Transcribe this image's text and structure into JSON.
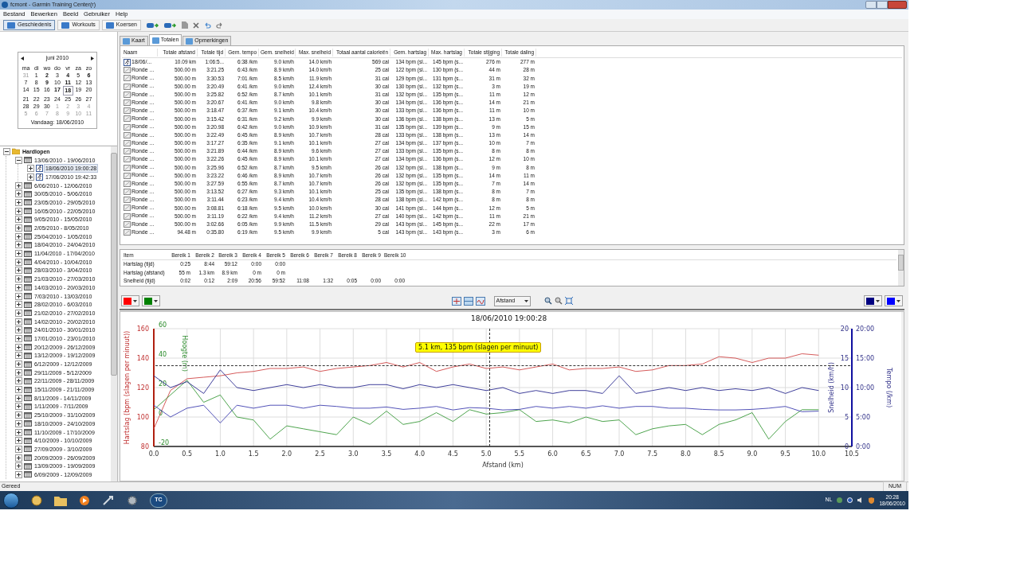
{
  "window": {
    "title": "fcmont - Garmin Training Center(r)"
  },
  "menu": [
    "Bestand",
    "Bewerken",
    "Beeld",
    "Gebruiker",
    "Help"
  ],
  "toolbar": {
    "views": [
      {
        "label": "Geschiedenis",
        "selected": true
      },
      {
        "label": "Workouts",
        "selected": false
      },
      {
        "label": "Koersen",
        "selected": false
      }
    ]
  },
  "calendar": {
    "month": "juni 2010",
    "weekdays": [
      "ma",
      "di",
      "wo",
      "do",
      "vr",
      "za",
      "zo"
    ],
    "weeks": [
      [
        {
          "d": "31",
          "kind": "other"
        },
        {
          "d": "1",
          "kind": "plain"
        },
        {
          "d": "2",
          "kind": "active"
        },
        {
          "d": "3",
          "kind": "plain"
        },
        {
          "d": "4",
          "kind": "active"
        },
        {
          "d": "5",
          "kind": "plain"
        },
        {
          "d": "6",
          "kind": "active"
        }
      ],
      [
        {
          "d": "7",
          "kind": "plain"
        },
        {
          "d": "8",
          "kind": "plain"
        },
        {
          "d": "9",
          "kind": "active"
        },
        {
          "d": "10",
          "kind": "plain"
        },
        {
          "d": "11",
          "kind": "active"
        },
        {
          "d": "12",
          "kind": "plain"
        },
        {
          "d": "13",
          "kind": "plain"
        }
      ],
      [
        {
          "d": "14",
          "kind": "plain"
        },
        {
          "d": "15",
          "kind": "plain"
        },
        {
          "d": "16",
          "kind": "plain"
        },
        {
          "d": "17",
          "kind": "active"
        },
        {
          "d": "18",
          "kind": "today"
        },
        {
          "d": "19",
          "kind": "plain"
        },
        {
          "d": "20",
          "kind": "plain"
        }
      ],
      [
        {
          "d": "21",
          "kind": "plain"
        },
        {
          "d": "22",
          "kind": "plain"
        },
        {
          "d": "23",
          "kind": "plain"
        },
        {
          "d": "24",
          "kind": "plain"
        },
        {
          "d": "25",
          "kind": "plain"
        },
        {
          "d": "26",
          "kind": "plain"
        },
        {
          "d": "27",
          "kind": "plain"
        }
      ],
      [
        {
          "d": "28",
          "kind": "plain"
        },
        {
          "d": "29",
          "kind": "plain"
        },
        {
          "d": "30",
          "kind": "plain"
        },
        {
          "d": "1",
          "kind": "other"
        },
        {
          "d": "2",
          "kind": "other"
        },
        {
          "d": "3",
          "kind": "other"
        },
        {
          "d": "4",
          "kind": "other"
        }
      ],
      [
        {
          "d": "5",
          "kind": "other"
        },
        {
          "d": "6",
          "kind": "other"
        },
        {
          "d": "7",
          "kind": "other"
        },
        {
          "d": "8",
          "kind": "other"
        },
        {
          "d": "9",
          "kind": "other"
        },
        {
          "d": "10",
          "kind": "other"
        },
        {
          "d": "11",
          "kind": "other"
        }
      ]
    ],
    "today": "Vandaag: 18/06/2010"
  },
  "tree": {
    "label": "Hardlopen",
    "kind": "folder",
    "expanded": true,
    "selected": false,
    "children": [
      {
        "label": "13/06/2010 - 19/06/2010",
        "kind": "week",
        "expanded": true,
        "selected": false,
        "children": [
          {
            "label": "18/06/2010 19:00:28",
            "kind": "activity",
            "expanded": false,
            "selected": true
          },
          {
            "label": "17/06/2010 19:42:33",
            "kind": "activity",
            "expanded": false,
            "selected": false
          }
        ]
      },
      {
        "label": "6/06/2010 - 12/06/2010",
        "kind": "week",
        "expanded": false,
        "selected": false
      },
      {
        "label": "30/05/2010 - 5/06/2010",
        "kind": "week",
        "expanded": false,
        "selected": false
      },
      {
        "label": "23/05/2010 - 29/05/2010",
        "kind": "week",
        "expanded": false,
        "selected": false
      },
      {
        "label": "16/05/2010 - 22/05/2010",
        "kind": "week",
        "expanded": false,
        "selected": false
      },
      {
        "label": "9/05/2010 - 15/05/2010",
        "kind": "week",
        "expanded": false,
        "selected": false
      },
      {
        "label": "2/05/2010 - 8/05/2010",
        "kind": "week",
        "expanded": false,
        "selected": false
      },
      {
        "label": "25/04/2010 - 1/05/2010",
        "kind": "week",
        "expanded": false,
        "selected": false
      },
      {
        "label": "18/04/2010 - 24/04/2010",
        "kind": "week",
        "expanded": false,
        "selected": false
      },
      {
        "label": "11/04/2010 - 17/04/2010",
        "kind": "week",
        "expanded": false,
        "selected": false
      },
      {
        "label": "4/04/2010 - 10/04/2010",
        "kind": "week",
        "expanded": false,
        "selected": false
      },
      {
        "label": "28/03/2010 - 3/04/2010",
        "kind": "week",
        "expanded": false,
        "selected": false
      },
      {
        "label": "21/03/2010 - 27/03/2010",
        "kind": "week",
        "expanded": false,
        "selected": false
      },
      {
        "label": "14/03/2010 - 20/03/2010",
        "kind": "week",
        "expanded": false,
        "selected": false
      },
      {
        "label": "7/03/2010 - 13/03/2010",
        "kind": "week",
        "expanded": false,
        "selected": false
      },
      {
        "label": "28/02/2010 - 6/03/2010",
        "kind": "week",
        "expanded": false,
        "selected": false
      },
      {
        "label": "21/02/2010 - 27/02/2010",
        "kind": "week",
        "expanded": false,
        "selected": false
      },
      {
        "label": "14/02/2010 - 20/02/2010",
        "kind": "week",
        "expanded": false,
        "selected": false
      },
      {
        "label": "24/01/2010 - 30/01/2010",
        "kind": "week",
        "expanded": false,
        "selected": false
      },
      {
        "label": "17/01/2010 - 23/01/2010",
        "kind": "week",
        "expanded": false,
        "selected": false
      },
      {
        "label": "20/12/2009 - 26/12/2009",
        "kind": "week",
        "expanded": false,
        "selected": false
      },
      {
        "label": "13/12/2009 - 19/12/2009",
        "kind": "week",
        "expanded": false,
        "selected": false
      },
      {
        "label": "6/12/2009 - 12/12/2009",
        "kind": "week",
        "expanded": false,
        "selected": false
      },
      {
        "label": "29/11/2009 - 5/12/2009",
        "kind": "week",
        "expanded": false,
        "selected": false
      },
      {
        "label": "22/11/2009 - 28/11/2009",
        "kind": "week",
        "expanded": false,
        "selected": false
      },
      {
        "label": "15/11/2009 - 21/11/2009",
        "kind": "week",
        "expanded": false,
        "selected": false
      },
      {
        "label": "8/11/2009 - 14/11/2009",
        "kind": "week",
        "expanded": false,
        "selected": false
      },
      {
        "label": "1/11/2009 - 7/11/2009",
        "kind": "week",
        "expanded": false,
        "selected": false
      },
      {
        "label": "25/10/2009 - 31/10/2009",
        "kind": "week",
        "expanded": false,
        "selected": false
      },
      {
        "label": "18/10/2009 - 24/10/2009",
        "kind": "week",
        "expanded": false,
        "selected": false
      },
      {
        "label": "11/10/2009 - 17/10/2009",
        "kind": "week",
        "expanded": false,
        "selected": false
      },
      {
        "label": "4/10/2009 - 10/10/2009",
        "kind": "week",
        "expanded": false,
        "selected": false
      },
      {
        "label": "27/09/2009 - 3/10/2009",
        "kind": "week",
        "expanded": false,
        "selected": false
      },
      {
        "label": "20/09/2009 - 26/09/2009",
        "kind": "week",
        "expanded": false,
        "selected": false
      },
      {
        "label": "13/09/2009 - 19/09/2009",
        "kind": "week",
        "expanded": false,
        "selected": false
      },
      {
        "label": "6/09/2009 - 12/09/2009",
        "kind": "week",
        "expanded": false,
        "selected": false
      }
    ]
  },
  "tabs": [
    {
      "label": "Kaart",
      "selected": false
    },
    {
      "label": "Totalen",
      "selected": true
    },
    {
      "label": "Opmerkingen",
      "selected": false
    }
  ],
  "laps": {
    "columns": [
      "Naam",
      "Totale afstand",
      "Totale tijd",
      "Gem. tempo",
      "Gem. snelheid",
      "Max. snelheid",
      "Totaal aantal calorieën",
      "Gem. hartslag",
      "Max. hartslag",
      "Totale stijging",
      "Totale daling"
    ],
    "rows": [
      {
        "kind": "activity",
        "cells": [
          "18/06/...",
          "10.09 km",
          "1:06:5...",
          "6:38 /km",
          "9.0 km/h",
          "14.0 km/h",
          "569 cal",
          "134 bpm (sl...",
          "145 bpm (s...",
          "276 m",
          "277 m"
        ]
      },
      {
        "kind": "lap",
        "cells": [
          "Ronde ...",
          "500.00 m",
          "3:21.25",
          "6:43 /km",
          "8.9 km/h",
          "14.0 km/h",
          "25 cal",
          "122 bpm (sl...",
          "130 bpm (s...",
          "44 m",
          "28 m"
        ]
      },
      {
        "kind": "lap",
        "cells": [
          "Ronde ...",
          "500.00 m",
          "3:30.53",
          "7:01 /km",
          "8.5 km/h",
          "11.9 km/h",
          "31 cal",
          "129 bpm (sl...",
          "131 bpm (s...",
          "31 m",
          "32 m"
        ]
      },
      {
        "kind": "lap",
        "cells": [
          "Ronde ...",
          "500.00 m",
          "3:20.49",
          "6:41 /km",
          "9.0 km/h",
          "12.4 km/h",
          "30 cal",
          "130 bpm (sl...",
          "132 bpm (s...",
          "3 m",
          "19 m"
        ]
      },
      {
        "kind": "lap",
        "cells": [
          "Ronde ...",
          "500.00 m",
          "3:25.82",
          "6:52 /km",
          "8.7 km/h",
          "10.1 km/h",
          "31 cal",
          "132 bpm (sl...",
          "135 bpm (s...",
          "11 m",
          "12 m"
        ]
      },
      {
        "kind": "lap",
        "cells": [
          "Ronde ...",
          "500.00 m",
          "3:20.67",
          "6:41 /km",
          "9.0 km/h",
          "9.8 km/h",
          "30 cal",
          "134 bpm (sl...",
          "136 bpm (s...",
          "14 m",
          "21 m"
        ]
      },
      {
        "kind": "lap",
        "cells": [
          "Ronde ...",
          "500.00 m",
          "3:18.47",
          "6:37 /km",
          "9.1 km/h",
          "10.4 km/h",
          "30 cal",
          "133 bpm (sl...",
          "136 bpm (s...",
          "11 m",
          "10 m"
        ]
      },
      {
        "kind": "lap",
        "cells": [
          "Ronde ...",
          "500.00 m",
          "3:15.42",
          "6:31 /km",
          "9.2 km/h",
          "9.9 km/h",
          "30 cal",
          "136 bpm (sl...",
          "138 bpm (s...",
          "13 m",
          "5 m"
        ]
      },
      {
        "kind": "lap",
        "cells": [
          "Ronde ...",
          "500.00 m",
          "3:20.98",
          "6:42 /km",
          "9.0 km/h",
          "10.9 km/h",
          "31 cal",
          "135 bpm (sl...",
          "139 bpm (s...",
          "9 m",
          "15 m"
        ]
      },
      {
        "kind": "lap",
        "cells": [
          "Ronde ...",
          "500.00 m",
          "3:22.49",
          "6:45 /km",
          "8.9 km/h",
          "10.7 km/h",
          "28 cal",
          "133 bpm (sl...",
          "138 bpm (s...",
          "13 m",
          "14 m"
        ]
      },
      {
        "kind": "lap",
        "cells": [
          "Ronde ...",
          "500.00 m",
          "3:17.27",
          "6:35 /km",
          "9.1 km/h",
          "10.1 km/h",
          "27 cal",
          "134 bpm (sl...",
          "137 bpm (s...",
          "10 m",
          "7 m"
        ]
      },
      {
        "kind": "lap",
        "cells": [
          "Ronde ...",
          "500.00 m",
          "3:21.89",
          "6:44 /km",
          "8.9 km/h",
          "9.6 km/h",
          "27 cal",
          "133 bpm (sl...",
          "135 bpm (s...",
          "8 m",
          "8 m"
        ]
      },
      {
        "kind": "lap",
        "cells": [
          "Ronde ...",
          "500.00 m",
          "3:22.26",
          "6:45 /km",
          "8.9 km/h",
          "10.1 km/h",
          "27 cal",
          "134 bpm (sl...",
          "136 bpm (s...",
          "12 m",
          "10 m"
        ]
      },
      {
        "kind": "lap",
        "cells": [
          "Ronde ...",
          "500.00 m",
          "3:25.96",
          "6:52 /km",
          "8.7 km/h",
          "9.5 km/h",
          "26 cal",
          "132 bpm (sl...",
          "138 bpm (s...",
          "9 m",
          "8 m"
        ]
      },
      {
        "kind": "lap",
        "cells": [
          "Ronde ...",
          "500.00 m",
          "3:23.22",
          "6:46 /km",
          "8.9 km/h",
          "10.7 km/h",
          "26 cal",
          "132 bpm (sl...",
          "135 bpm (s...",
          "14 m",
          "11 m"
        ]
      },
      {
        "kind": "lap",
        "cells": [
          "Ronde ...",
          "500.00 m",
          "3:27.59",
          "6:55 /km",
          "8.7 km/h",
          "10.7 km/h",
          "26 cal",
          "132 bpm (sl...",
          "135 bpm (s...",
          "7 m",
          "14 m"
        ]
      },
      {
        "kind": "lap",
        "cells": [
          "Ronde ...",
          "500.00 m",
          "3:13.52",
          "6:27 /km",
          "9.3 km/h",
          "10.1 km/h",
          "25 cal",
          "135 bpm (sl...",
          "138 bpm (s...",
          "8 m",
          "7 m"
        ]
      },
      {
        "kind": "lap",
        "cells": [
          "Ronde ...",
          "500.00 m",
          "3:11.44",
          "6:23 /km",
          "9.4 km/h",
          "10.4 km/h",
          "28 cal",
          "138 bpm (sl...",
          "142 bpm (s...",
          "8 m",
          "8 m"
        ]
      },
      {
        "kind": "lap",
        "cells": [
          "Ronde ...",
          "500.00 m",
          "3:08.81",
          "6:18 /km",
          "9.5 km/h",
          "10.0 km/h",
          "30 cal",
          "141 bpm (sl...",
          "144 bpm (s...",
          "12 m",
          "5 m"
        ]
      },
      {
        "kind": "lap",
        "cells": [
          "Ronde ...",
          "500.00 m",
          "3:11.19",
          "6:22 /km",
          "9.4 km/h",
          "11.2 km/h",
          "27 cal",
          "140 bpm (sl...",
          "142 bpm (s...",
          "11 m",
          "21 m"
        ]
      },
      {
        "kind": "lap",
        "cells": [
          "Ronde ...",
          "500.00 m",
          "3:02.66",
          "6:05 /km",
          "9.9 km/h",
          "11.5 km/h",
          "29 cal",
          "143 bpm (sl...",
          "145 bpm (s...",
          "22 m",
          "17 m"
        ]
      },
      {
        "kind": "lap",
        "cells": [
          "Ronde ...",
          "94.48 m",
          "0:35.80",
          "6:19 /km",
          "9.5 km/h",
          "9.9 km/h",
          "5 cal",
          "143 bpm (sl...",
          "143 bpm (s...",
          "3 m",
          "6 m"
        ]
      }
    ]
  },
  "zones": {
    "columns": [
      "Item",
      "Bereik 1",
      "Bereik 2",
      "Bereik 3",
      "Bereik 4",
      "Bereik 5",
      "Bereik 6",
      "Bereik 7",
      "Bereik 8",
      "Bereik 9",
      "Bereik 10"
    ],
    "rows": [
      [
        "Hartslag (tijd)",
        "0:25",
        "8:44",
        "59:12",
        "0:00",
        "0:00"
      ],
      [
        "Hartslag (afstand)",
        "55 m",
        "1.3 km",
        "8.9 km",
        "0 m",
        "0 m"
      ],
      [
        "Snelheid (tijd)",
        "0:02",
        "0:12",
        "2:09",
        "20:56",
        "59:52",
        "11:08",
        "1:32",
        "0:05",
        "0:00",
        "0:00"
      ]
    ]
  },
  "chart_toolbar": {
    "left_colors": [
      {
        "color": "#ff0000"
      },
      {
        "color": "#008000"
      }
    ],
    "x_axis": "Afstand",
    "right_colors": [
      {
        "color": "#000080"
      },
      {
        "color": "#0000ff"
      }
    ]
  },
  "chart": {
    "title": "18/06/2010 19:00:28",
    "tooltip": "5.1 km, 135 bpm (slagen per minuut)",
    "plots": [
      {
        "kind": "heartrate",
        "chart_data": {
          "type": "line",
          "grid": true,
          "xlabel": "Afstand (km)",
          "ylabel": "Hartslag (bpm (slagen per minuut))",
          "xlim": [
            0,
            10.5
          ],
          "ylim": [
            80,
            160
          ],
          "x": [
            0,
            0.25,
            0.5,
            0.75,
            1,
            1.25,
            1.5,
            1.75,
            2,
            2.25,
            2.5,
            2.75,
            3,
            3.25,
            3.5,
            3.75,
            4,
            4.25,
            4.5,
            4.75,
            5,
            5.25,
            5.5,
            5.75,
            6,
            6.25,
            6.5,
            6.75,
            7,
            7.25,
            7.5,
            7.75,
            8,
            8.25,
            8.5,
            8.75,
            9,
            9.25,
            9.5,
            9.75,
            10
          ],
          "xticks": [
            {
              "value": 0,
              "label": "0.0"
            },
            {
              "value": 0.5,
              "label": "0.5"
            },
            {
              "value": 1,
              "label": "1.0"
            },
            {
              "value": 1.5,
              "label": "1.5"
            },
            {
              "value": 2,
              "label": "2.0"
            },
            {
              "value": 2.5,
              "label": "2.5"
            },
            {
              "value": 3,
              "label": "3.0"
            },
            {
              "value": 3.5,
              "label": "3.5"
            },
            {
              "value": 4,
              "label": "4.0"
            },
            {
              "value": 4.5,
              "label": "4.5"
            },
            {
              "value": 5,
              "label": "5.0"
            },
            {
              "value": 5.5,
              "label": "5.5"
            },
            {
              "value": 6,
              "label": "6.0"
            },
            {
              "value": 6.5,
              "label": "6.5"
            },
            {
              "value": 7,
              "label": "7.0"
            },
            {
              "value": 7.5,
              "label": "7.5"
            },
            {
              "value": 8,
              "label": "8.0"
            },
            {
              "value": 8.5,
              "label": "8.5"
            },
            {
              "value": 9,
              "label": "9.0"
            },
            {
              "value": 9.5,
              "label": "9.5"
            },
            {
              "value": 10,
              "label": "10.0"
            },
            {
              "value": 10.5,
              "label": "10.5"
            }
          ],
          "yticks": [
            80,
            100,
            120,
            140,
            160
          ],
          "series": [
            {
              "color": "#d04848",
              "values": [
                92,
                118,
                126,
                127,
                128,
                130,
                131,
                133,
                133,
                134,
                131,
                133,
                134,
                135,
                137,
                134,
                137,
                131,
                134,
                136,
                133,
                134,
                132,
                134,
                136,
                132,
                133,
                133,
                134,
                131,
                132,
                135,
                135,
                136,
                141,
                140,
                137,
                140,
                140,
                143,
                142
              ]
            }
          ]
        }
      },
      {
        "kind": "elevation",
        "chart_data": {
          "type": "line",
          "ylabel": "Hoogte (m)",
          "xlim": [
            0,
            10.5
          ],
          "ylim": [
            -20,
            60
          ],
          "x": [
            0,
            0.25,
            0.5,
            0.75,
            1,
            1.25,
            1.5,
            1.75,
            2,
            2.25,
            2.5,
            2.75,
            3,
            3.25,
            3.5,
            3.75,
            4,
            4.25,
            4.5,
            4.75,
            5,
            5.25,
            5.5,
            5.75,
            6,
            6.25,
            6.5,
            6.75,
            7,
            7.25,
            7.5,
            7.75,
            8,
            8.25,
            8.5,
            8.75,
            9,
            9.25,
            9.5,
            9.75,
            10
          ],
          "yticks": [
            -20,
            0,
            20,
            40,
            60
          ],
          "series": [
            {
              "color": "#3a9a3a",
              "values": [
                5,
                15,
                25,
                10,
                15,
                0,
                -2,
                -15,
                -6,
                -8,
                -10,
                -12,
                0,
                -5,
                4,
                -5,
                -3,
                3,
                -3,
                5,
                2,
                3,
                5,
                -3,
                -2,
                -4,
                0,
                -3,
                -2,
                -12,
                -8,
                -6,
                -5,
                -12,
                -5,
                -2,
                3,
                -15,
                -3,
                5,
                5
              ]
            }
          ]
        }
      },
      {
        "kind": "speed",
        "chart_data": {
          "type": "line",
          "ylabel": "Snelheid (km/h)",
          "xlim": [
            0,
            10.5
          ],
          "ylim": [
            0,
            20
          ],
          "x": [
            0,
            0.25,
            0.5,
            0.75,
            1,
            1.25,
            1.5,
            1.75,
            2,
            2.25,
            2.5,
            2.75,
            3,
            3.25,
            3.5,
            3.75,
            4,
            4.25,
            4.5,
            4.75,
            5,
            5.25,
            5.5,
            5.75,
            6,
            6.25,
            6.5,
            6.75,
            7,
            7.25,
            7.5,
            7.75,
            8,
            8.25,
            8.5,
            8.75,
            9,
            9.25,
            9.5,
            9.75,
            10
          ],
          "yticks": [
            0,
            5,
            10,
            15,
            20
          ],
          "series": [
            {
              "color": "#2a2a90",
              "values": [
                12,
                10,
                11,
                9,
                13,
                10,
                9.5,
                10,
                10.5,
                10,
                10.5,
                10,
                10,
                10.5,
                10.5,
                9.8,
                10.5,
                10,
                10.5,
                10,
                9.5,
                10,
                9,
                9.5,
                9,
                9.5,
                9.5,
                9,
                12,
                9,
                9.5,
                10,
                9.5,
                10,
                9.5,
                9.8,
                9.5,
                10,
                9,
                10,
                9.5
              ]
            }
          ]
        }
      },
      {
        "kind": "pace",
        "chart_data": {
          "type": "line",
          "ylabel": "Tempo (/km)",
          "xlim": [
            0,
            10.5
          ],
          "ylim": [
            0,
            20
          ],
          "x": [
            0,
            0.25,
            0.5,
            0.75,
            1,
            1.25,
            1.5,
            1.75,
            2,
            2.25,
            2.5,
            2.75,
            3,
            3.25,
            3.5,
            3.75,
            4,
            4.25,
            4.5,
            4.75,
            5,
            5.25,
            5.5,
            5.75,
            6,
            6.25,
            6.5,
            6.75,
            7,
            7.25,
            7.5,
            7.75,
            8,
            8.25,
            8.5,
            8.75,
            9,
            9.25,
            9.5,
            9.75,
            10
          ],
          "yticks": [
            {
              "value": 0,
              "label": "0:00"
            },
            {
              "value": 5,
              "label": "5:00"
            },
            {
              "value": 10,
              "label": "10:00"
            },
            {
              "value": 15,
              "label": "15:00"
            },
            {
              "value": 20,
              "label": "20:00"
            }
          ],
          "series": [
            {
              "color": "#4040b0",
              "values": [
                7,
                5,
                6.5,
                7,
                4,
                7,
                6.5,
                7,
                7,
                6.5,
                7,
                6.8,
                6.5,
                6.5,
                6.7,
                6.3,
                6.5,
                6.8,
                6.2,
                6.6,
                6.5,
                6.2,
                6.3,
                6.8,
                6.5,
                6.8,
                6.5,
                6.9,
                6.5,
                6.8,
                6.8,
                6.5,
                6.5,
                6.3,
                6.2,
                6.2,
                6.3,
                6.5,
                6.8,
                5.9,
                6
              ]
            }
          ]
        }
      }
    ]
  },
  "status_bar": {
    "text": "Gereed",
    "num": "NUM"
  },
  "taskbar": {
    "app_label": "TC",
    "lang": "NL",
    "time": "20:28",
    "date": "18/06/2010"
  }
}
